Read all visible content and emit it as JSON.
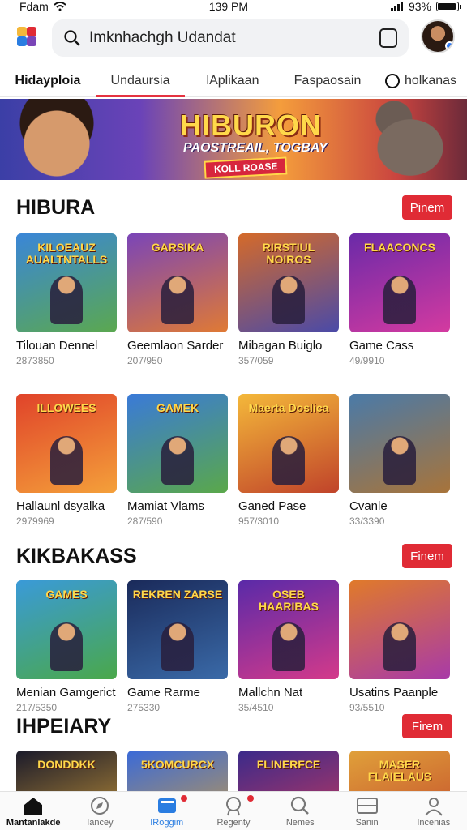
{
  "status_bar": {
    "carrier": "Fdam",
    "time": "139 PM",
    "battery": "93%",
    "battery_level": 0.93
  },
  "search": {
    "value": "Imknhachgh Udandat"
  },
  "tabs": [
    {
      "label": "Hidayploia",
      "active": true
    },
    {
      "label": "Undaursia",
      "underlined": true
    },
    {
      "label": "lAplikaan"
    },
    {
      "label": "Faspaosain"
    },
    {
      "label": "holkanas",
      "icon": "circle-badge-icon"
    }
  ],
  "banner": {
    "title": "HIBURON",
    "subtitle": "PAOSTREAIL, TOGBAY",
    "tag": "KOLL ROASE"
  },
  "sections": [
    {
      "title": "HIBURA",
      "button": "Pinem",
      "rows": [
        [
          {
            "name": "Tilouan Dennel",
            "meta": "2873850",
            "art_title": "KILOEAUZ AUALTNTALLS",
            "colors": [
              "#3a86d8",
              "#5ba84f"
            ]
          },
          {
            "name": "Geemlaon Sarder",
            "meta": "207/950",
            "art_title": "GARSIKA",
            "colors": [
              "#7a45b8",
              "#e07a34"
            ]
          },
          {
            "name": "Mibagan Buiglo",
            "meta": "357/059",
            "art_title": "RIRSTIUL NOIROS",
            "colors": [
              "#d46a2a",
              "#4a4aa8"
            ]
          },
          {
            "name": "Game Cass",
            "meta": "49/9910",
            "art_title": "FLAACONCS",
            "colors": [
              "#6a2aa8",
              "#d43aa0"
            ]
          }
        ],
        [
          {
            "name": "Hallaunl dsyalka",
            "meta": "2979969",
            "art_title": "ILLOWEES",
            "colors": [
              "#e0432a",
              "#f4a03a"
            ]
          },
          {
            "name": "Mamiat Vlams",
            "meta": "287/590",
            "art_title": "GAMEK",
            "colors": [
              "#3a7ad8",
              "#5aa84a"
            ]
          },
          {
            "name": "Ganed Pase",
            "meta": "957/3010",
            "art_title": "Maerta Doslica",
            "colors": [
              "#f4b83a",
              "#c0432a"
            ]
          },
          {
            "name": "Cvanle",
            "meta": "33/3390",
            "art_title": "",
            "colors": [
              "#4a7aa8",
              "#a8743a"
            ]
          }
        ]
      ]
    },
    {
      "title": "KIKBAKASS",
      "button": "Finem",
      "rows": [
        [
          {
            "name": "Menian Gamgerict",
            "meta": "217/5350",
            "art_title": "GAMES",
            "colors": [
              "#3a9ad8",
              "#4aa84a"
            ]
          },
          {
            "name": "Game Rarme",
            "meta": "275330",
            "art_title": "REKREN ZARSE",
            "colors": [
              "#1a2a5a",
              "#3a6aa8"
            ]
          },
          {
            "name": "Mallchn Nat",
            "meta": "35/4510",
            "art_title": "OSEB HAARIBAS",
            "colors": [
              "#5a2aa8",
              "#d43a8a"
            ]
          },
          {
            "name": "Usatins Paanple",
            "meta": "93/5510",
            "art_title": "",
            "colors": [
              "#e07a2a",
              "#a83aa8"
            ]
          }
        ]
      ]
    },
    {
      "title": "IHPEIARY",
      "button": "Firem",
      "rows": [
        [
          {
            "name": "",
            "meta": "",
            "art_title": "DONDDKK",
            "colors": [
              "#1a1a2a",
              "#d4a03a"
            ]
          },
          {
            "name": "",
            "meta": "",
            "art_title": "5KOMCURCX",
            "colors": [
              "#3a6ad8",
              "#d4a03a"
            ]
          },
          {
            "name": "",
            "meta": "",
            "art_title": "FLINERFCE",
            "colors": [
              "#3a2a8a",
              "#d43a5a"
            ]
          },
          {
            "name": "",
            "meta": "",
            "art_title": "MASER FLAIELAUS",
            "colors": [
              "#e0a03a",
              "#c0432a"
            ]
          }
        ]
      ]
    }
  ],
  "bottom_nav": [
    {
      "label": "Mantanlakde",
      "icon": "home-icon",
      "active": true
    },
    {
      "label": "Iancey",
      "icon": "compass-icon"
    },
    {
      "label": "IRoggim",
      "icon": "library-icon",
      "highlight": true,
      "dot": true
    },
    {
      "label": "Regenty",
      "icon": "ranking-icon",
      "dot": true
    },
    {
      "label": "Nemes",
      "icon": "search-icon"
    },
    {
      "label": "Sanin",
      "icon": "tablet-icon"
    },
    {
      "label": "Incenias",
      "icon": "person-icon"
    }
  ],
  "colors": {
    "accent": "#e02b35",
    "link": "#2a7de1"
  }
}
